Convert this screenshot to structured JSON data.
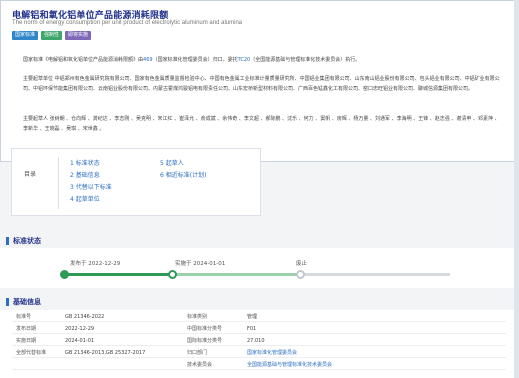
{
  "header": {
    "title": "电解铝和氧化铝单位产品能源消耗限额",
    "subtitle": "The norm of energy consumption per unit product of electrolytic aluminum and alumina",
    "tags": [
      "国家标准",
      "强制性",
      "即将实施"
    ]
  },
  "intro": {
    "p1_before": "国家标准《电解铝和氧化铝单位产品能源消耗限额》由",
    "p1_link1": "469",
    "p1_mid": "（国家标准化管理委员会）归口，委托",
    "p1_link2": "TC20",
    "p1_after": "（全国能源基础与管理标准化技术委员会）执行。",
    "p2": "主要起草单位 中铝郑州有色金属研究院有限公司、国家有色金属质量监督检验中心、中国有色金属工业标准计量质量研究所、中国铝业集团有限公司、山东南山铝业股份有限公司、包头铝业有限公司、中铝矿业有限公司、中铝环保节能集团有限公司、云南铝业股份有限公司、内蒙古霍煤鸿骏铝电有限责任公司、山东宏桥新型材料有限公司、广西百色锰鑫化工有限公司、窑口忠旺铝业有限公司、聊城信源集团有限公司。",
    "p3": "主要起草人 张树朝 、仓向辉 、龚纪达 、李志刚 、吴克明 、宋江红 、崔泽允 、俞成斌 、余伟奇 、李文超 、郝际鹏 、沈乐 、何力 、窦帆 、房辉 、杨万量 、刘通军 、李海明 、王锋 、赵志强 、谢清申 、邓素萍 、李新华 、王晓磊 、吴琪 、宋世鑫 。"
  },
  "toc": {
    "label": "目录",
    "col1": [
      "1 标准状态",
      "2 基础信息",
      "3 代替以下标准",
      "4 起草单位"
    ],
    "col2": [
      "5 起草人",
      "6 相近标准(计划)"
    ]
  },
  "status": {
    "section_title": "标准状态",
    "published": "发布于 2022-12-29",
    "implemented": "实施于 2024-01-01",
    "abolished": "废止"
  },
  "basic": {
    "section_title": "基础信息",
    "rows": [
      {
        "k1": "标准号",
        "v1": "GB 21346-2022",
        "k2": "标准类别",
        "v2": "管理",
        "link": false
      },
      {
        "k1": "发布日期",
        "v1": "2022-12-29",
        "k2": "中国标准分类号",
        "v2": "F01",
        "link": false
      },
      {
        "k1": "实施日期",
        "v1": "2024-01-01",
        "k2": "国际标准分类号",
        "v2": "27.010",
        "link": false
      },
      {
        "k1": "全部代替标准",
        "v1": "GB 21346-2013,GB 25327-2017",
        "k2": "归口部门",
        "v2": "国家标准化管理委员会",
        "link": true
      },
      {
        "k1": "",
        "v1": "",
        "k2": "技术委员会",
        "v2": "全国能源基础与管理标准化技术委员会",
        "link": true
      }
    ]
  },
  "colors": {
    "accent": "#2b6ec3",
    "title": "#22318a",
    "done": "#2f9a58"
  }
}
